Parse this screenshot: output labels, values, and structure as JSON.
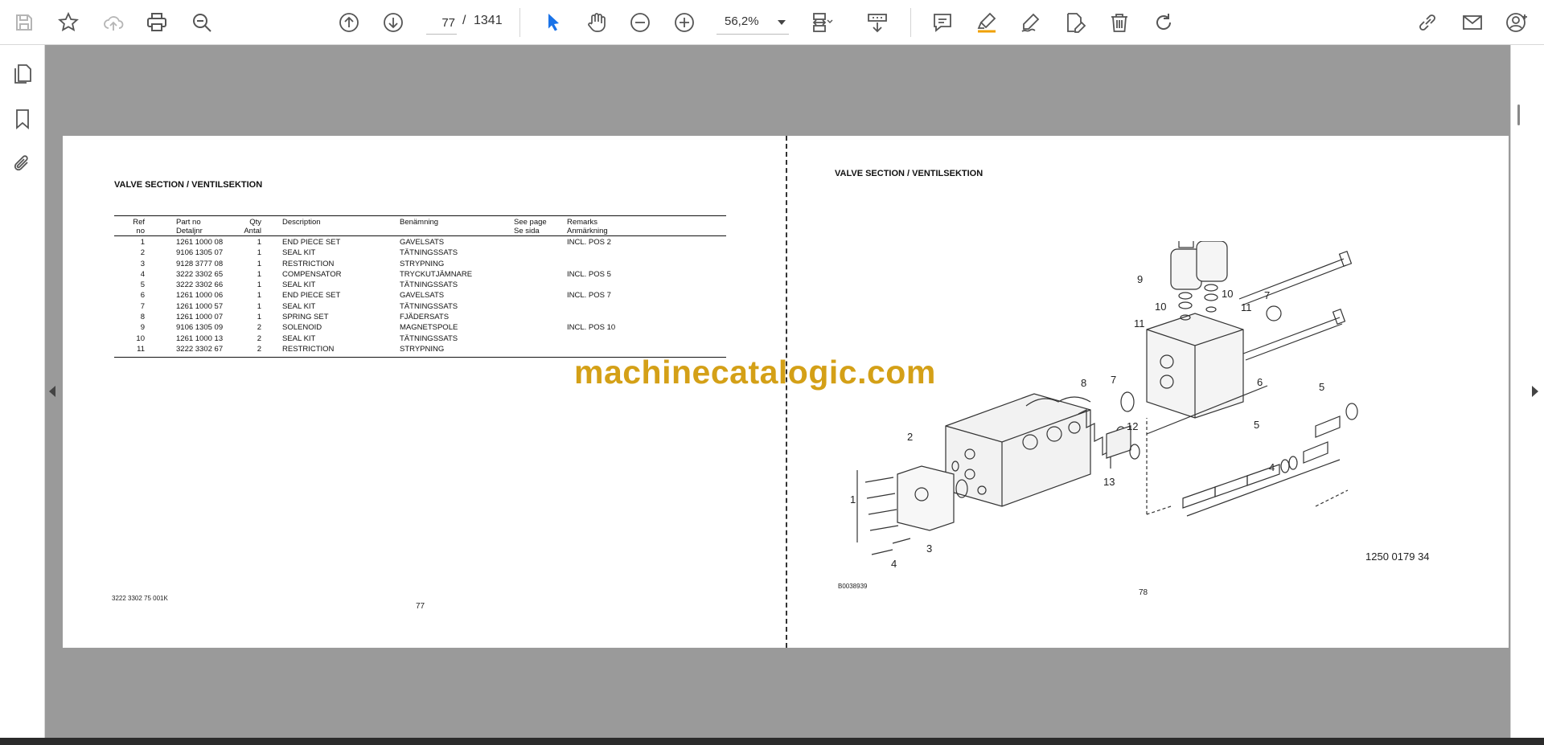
{
  "toolbar": {
    "icons": [
      "save-icon",
      "bookmark-star-icon",
      "upload-cloud-icon",
      "print-icon",
      "zoom-search-icon",
      "prev-page-icon",
      "next-page-icon",
      "select-cursor-icon",
      "hand-pan-icon",
      "zoom-out-icon",
      "zoom-in-icon",
      "fit-page-icon",
      "scroll-mode-icon",
      "comment-icon",
      "highlight-pen-icon",
      "draw-sign-icon",
      "edit-text-icon",
      "delete-trash-icon",
      "rotate-icon",
      "share-link-icon",
      "email-icon",
      "add-user-icon"
    ],
    "current_page": "77",
    "page_separator": "/",
    "page_count": "1341",
    "zoom_value": "56,2%"
  },
  "sidebar": {
    "icons": [
      "pages-thumbnail-icon",
      "bookmarks-icon",
      "attachments-icon"
    ]
  },
  "left_page": {
    "title": "VALVE SECTION / VENTILSEKTION",
    "headers": {
      "ref": [
        "Ref",
        "no"
      ],
      "part": [
        "Part no",
        "Detaljnr"
      ],
      "qty": [
        "Qty",
        "Antal"
      ],
      "desc": "Description",
      "ben": "Benämning",
      "see": [
        "See page",
        "Se sida"
      ],
      "rem": [
        "Remarks",
        "Anmärkning"
      ]
    },
    "rows": [
      {
        "ref": "1",
        "part": "1261 1000 08",
        "qty": "1",
        "desc": "END PIECE SET",
        "ben": "GAVELSATS",
        "see": "",
        "rem": "INCL. POS 2"
      },
      {
        "ref": "2",
        "part": "9106 1305 07",
        "qty": "1",
        "desc": "SEAL KIT",
        "ben": "TÄTNINGSSATS",
        "see": "",
        "rem": ""
      },
      {
        "ref": "3",
        "part": "9128 3777 08",
        "qty": "1",
        "desc": "RESTRICTION",
        "ben": "STRYPNING",
        "see": "",
        "rem": ""
      },
      {
        "ref": "4",
        "part": "3222 3302 65",
        "qty": "1",
        "desc": "COMPENSATOR",
        "ben": "TRYCKUTJÄMNARE",
        "see": "",
        "rem": "INCL. POS 5"
      },
      {
        "ref": "5",
        "part": "3222 3302 66",
        "qty": "1",
        "desc": "SEAL KIT",
        "ben": "TÄTNINGSSATS",
        "see": "",
        "rem": ""
      },
      {
        "ref": "6",
        "part": "1261 1000 06",
        "qty": "1",
        "desc": "END PIECE SET",
        "ben": "GAVELSATS",
        "see": "",
        "rem": "INCL. POS 7"
      },
      {
        "ref": "7",
        "part": "1261 1000 57",
        "qty": "1",
        "desc": "SEAL KIT",
        "ben": "TÄTNINGSSATS",
        "see": "",
        "rem": ""
      },
      {
        "ref": "8",
        "part": "1261 1000 07",
        "qty": "1",
        "desc": "SPRING SET",
        "ben": "FJÄDERSATS",
        "see": "",
        "rem": ""
      },
      {
        "ref": "9",
        "part": "9106 1305 09",
        "qty": "2",
        "desc": "SOLENOID",
        "ben": "MAGNETSPOLE",
        "see": "",
        "rem": "INCL. POS 10"
      },
      {
        "ref": "10",
        "part": "1261 1000 13",
        "qty": "2",
        "desc": "SEAL KIT",
        "ben": "TÄTNINGSSATS",
        "see": "",
        "rem": ""
      },
      {
        "ref": "11",
        "part": "3222 3302 67",
        "qty": "2",
        "desc": "RESTRICTION",
        "ben": "STRYPNING",
        "see": "",
        "rem": ""
      }
    ],
    "doc_code": "3222 3302 75  001K",
    "page_number": "77"
  },
  "right_page": {
    "title": "VALVE SECTION / VENTILSEKTION",
    "drawing_code": "B0038939",
    "figure_ref": "1250 0179 34",
    "page_number": "78",
    "callouts": [
      "1",
      "2",
      "3",
      "4",
      "4",
      "5",
      "5",
      "6",
      "7",
      "7",
      "8",
      "9",
      "10",
      "10",
      "11",
      "11",
      "12",
      "13"
    ]
  },
  "watermark": "machinecatalogic.com"
}
